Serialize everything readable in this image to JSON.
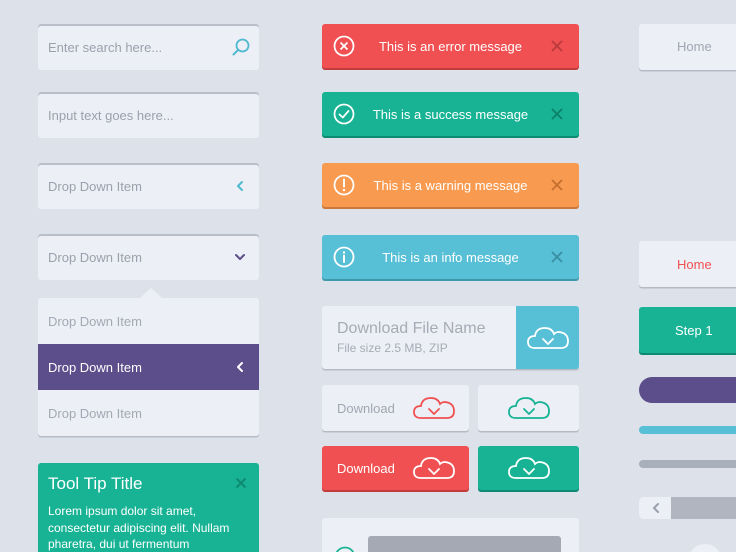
{
  "inputs": {
    "search_placeholder": "Enter search here...",
    "text_placeholder": "Input text goes here..."
  },
  "dropdown_closed": {
    "label": "Drop Down Item"
  },
  "dropdown_open": {
    "label": "Drop Down Item",
    "options": [
      {
        "label": "Drop Down Item",
        "selected": false
      },
      {
        "label": "Drop Down Item",
        "selected": true
      },
      {
        "label": "Drop Down Item",
        "selected": false
      }
    ]
  },
  "tooltip": {
    "title": "Tool Tip Title",
    "body": "Lorem ipsum dolor sit amet, consectetur adipiscing elit. Nullam pharetra, dui ut fermentum"
  },
  "alerts": {
    "error": "This is an error message",
    "success": "This is a success message",
    "warning": "This is a warning message",
    "info": "This is an info message"
  },
  "download_file": {
    "name": "Download File Name",
    "meta": "File size  2.5 MB, ZIP"
  },
  "download_buttons": {
    "label": "Download"
  },
  "nav": {
    "home_1": "Home",
    "home_2": "Home",
    "step": "Step 1"
  },
  "colors": {
    "background": "#dde1e9",
    "card": "#eceff6",
    "error": "#f05052",
    "success": "#17b394",
    "warning": "#f89a4f",
    "info": "#57bfd6",
    "purple": "#5b4e8a",
    "text_muted": "#9ba1ac"
  },
  "icons": {
    "search": "search-icon",
    "chevron_left": "chevron-left-icon",
    "chevron_down": "chevron-down-icon",
    "close": "close-icon",
    "cloud_download": "cloud-download-icon"
  }
}
